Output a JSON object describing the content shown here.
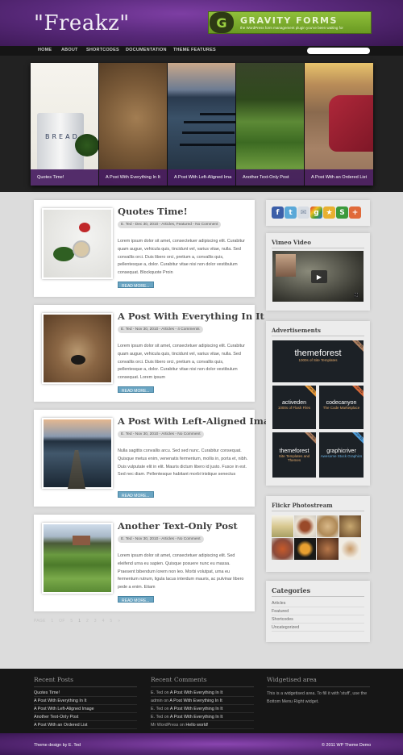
{
  "header": {
    "logo": "\"Freakz\"",
    "banner": {
      "title": "GRAVITY FORMS",
      "tagline": "the WordPress form management plugin you've been waiting for",
      "logo_letter": "G"
    }
  },
  "nav": {
    "items": [
      "HOME",
      "ABOUT",
      "SHORTCODES",
      "DOCUMENTATION",
      "THEME FEATURES"
    ],
    "search_placeholder": ""
  },
  "slider": {
    "slides": [
      {
        "caption": "Quotes Time!",
        "image": "bread-pot"
      },
      {
        "caption": "A Post With Everything In It",
        "image": "bear"
      },
      {
        "caption": "A Post With Left-Aligned Ima",
        "image": "dock-lake"
      },
      {
        "caption": "Another Text-Only Post",
        "image": "hedge-maze"
      },
      {
        "caption": "A Post With an Ordered List",
        "image": "red-car"
      }
    ],
    "pot_label": "BREAD"
  },
  "posts": [
    {
      "title": "Quotes Time!",
      "meta": "E. Ted - Dec 30, 2010 - Articles, Featured - No Comment",
      "excerpt": "Lorem ipsum dolor sit amet, consectetuer adipiscing elit. Curabitur quam augue, vehicula quis, tincidunt vel, varius vitae, nulla. Sed convallis orci. Duis libero orci, pretium a, convallis quis, pellentesque a, dolor. Curabitur vitae nisi non dolor vestibulum consequat. Blockquote Proin",
      "read_more": "READ MORE..."
    },
    {
      "title": "A Post With Everything In It",
      "meta": "E. Ted - Nov 30, 2010 - Articles - 4 Comments",
      "excerpt": "Lorem ipsum dolor sit amet, consectetuer adipiscing elit. Curabitur quam augue, vehicula quis, tincidunt vel, varius vitae, nulla. Sed convallis orci. Duis libero orci, pretium a, convallis quis, pellentesque a, dolor. Curabitur vitae nisi non dolor vestibulum consequat. Lorem ipsum",
      "read_more": "READ MORE..."
    },
    {
      "title": "A Post With Left-Aligned Image",
      "meta": "E. Ted - Nov 30, 2010 - Articles - No Comment",
      "excerpt": "Nulla sagittis convallis arcu. Sed sed nunc. Curabitur consequat. Quisque metus enim, venenatis fermentum, mollis in, porta et, nibh. Duis vulputate elit in elit. Mauris dictum libero id justo. Fusce in est. Sed nec diam. Pellentesque habitant morbi tristique senectus",
      "read_more": "READ MORE..."
    },
    {
      "title": "Another Text-Only Post",
      "meta": "E. Ted - Nov 30, 2010 - Articles - No Comment",
      "excerpt": "Lorem ipsum dolor sit amet, consectetuer adipiscing elit. Sed eleifend urna eu sapien. Quisque posuere nunc eu massa. Praesent bibendum lorem non leo. Morbi volutpat, urna eu fermentum rutrum, ligula lacus interdum mauris, ac pulvinar libero pede a enim. Etiam",
      "read_more": "READ MORE..."
    }
  ],
  "pagination": {
    "label": "PAGE 1 OF 5",
    "pages": [
      "1",
      "2",
      "3",
      "4",
      "5"
    ],
    "next": "»",
    "current": "1"
  },
  "sidebar": {
    "social": [
      {
        "name": "facebook",
        "glyph": "f",
        "color": "#3b5ea8"
      },
      {
        "name": "twitter",
        "glyph": "t",
        "color": "#5aa8d8"
      },
      {
        "name": "email",
        "glyph": "✉",
        "color": "#d8dde4"
      },
      {
        "name": "google",
        "glyph": "g",
        "color": "#4f9a3c"
      },
      {
        "name": "favorites",
        "glyph": "★",
        "color": "#e8b030"
      },
      {
        "name": "stumbleupon",
        "glyph": "S",
        "color": "#3b9a3c"
      },
      {
        "name": "more",
        "glyph": "+",
        "color": "#e06a3a"
      }
    ],
    "vimeo_title": "Vimeo Video",
    "ads_title": "Advertisements",
    "ads": [
      {
        "name": "themeforest",
        "sub": "1000s of Site Templates",
        "ribbon": "From $5"
      },
      {
        "name": "activeden",
        "sub": "1000s of Flash Files",
        "ribbon": "From $1"
      },
      {
        "name": "codecanyon",
        "sub": "The Code Marketplace",
        "ribbon": "From $2"
      },
      {
        "name": "themeforest",
        "sub": "Site Templates and Themes",
        "ribbon": "From $5"
      },
      {
        "name": "graphicriver",
        "sub": "Awesome Stock Graphics",
        "ribbon": "From $1"
      }
    ],
    "flickr_title": "Flickr Photostream",
    "categories_title": "Categories",
    "categories": [
      "Articles",
      "Featured",
      "Shortcodes",
      "Uncategorized"
    ]
  },
  "footer": {
    "recent_posts_title": "Recent Posts",
    "recent_posts": [
      "Quotes Time!",
      "A Post With Everything In It",
      "A Post With Left-Aligned Image",
      "Another Text-Only Post",
      "A Post With an Ordered List"
    ],
    "recent_comments_title": "Recent Comments",
    "recent_comments": [
      {
        "author": "E. Ted",
        "on": "on",
        "post": "A Post With Everything In It"
      },
      {
        "author": "admin",
        "on": "on",
        "post": "A Post With Everything In It"
      },
      {
        "author": "E. Ted",
        "on": "on",
        "post": "A Post With Everything In It"
      },
      {
        "author": "E. Ted",
        "on": "on",
        "post": "A Post With Everything In It"
      },
      {
        "author": "Mr WordPress",
        "on": "on",
        "post": "Hello world!"
      }
    ],
    "widget_title": "Widgetised area",
    "widget_text": "This is a widgetised area. To fill it with 'stuff', use the Bottom Menu Right widget.",
    "credit": "Theme design by E. Ted",
    "copyright": "© 2011 WP Theme Demo"
  }
}
